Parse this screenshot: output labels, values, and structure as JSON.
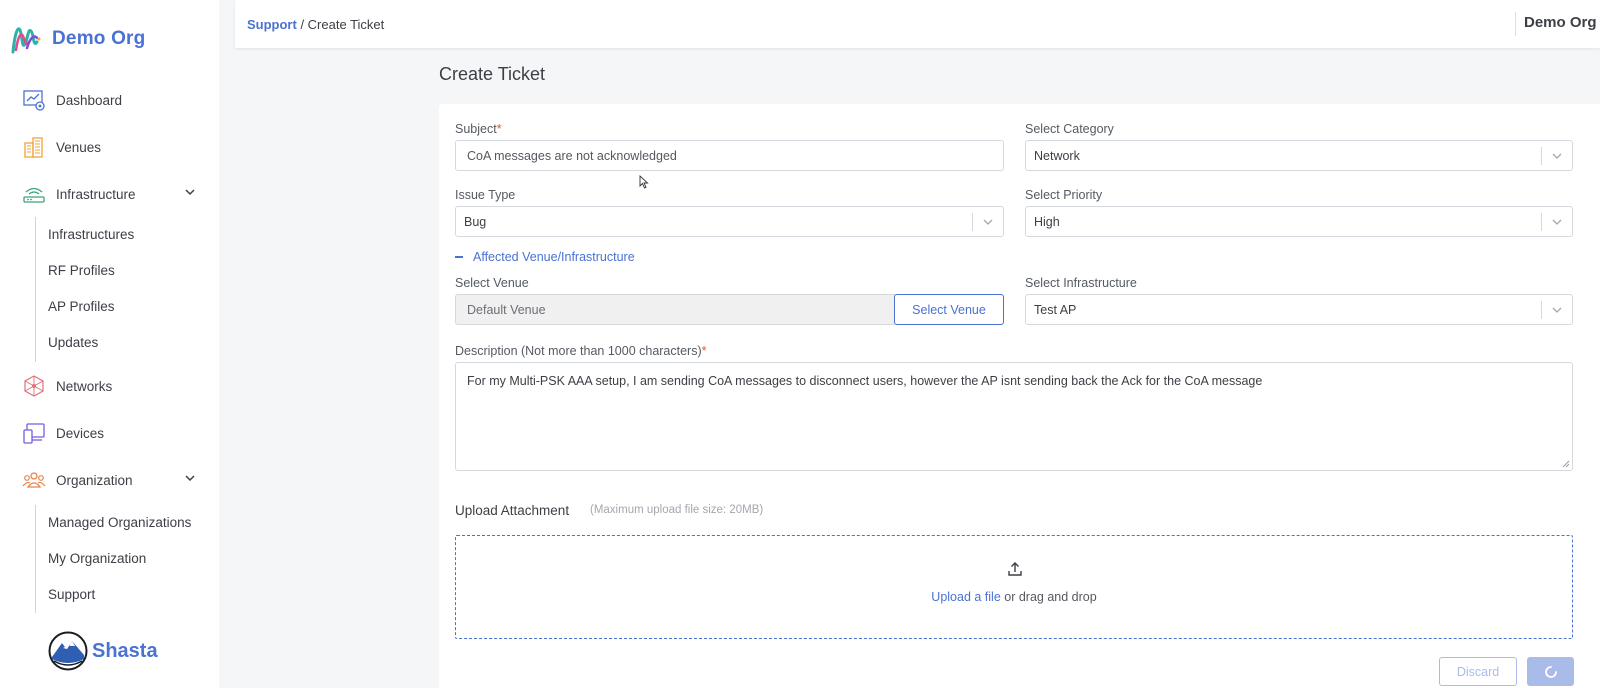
{
  "sidebar": {
    "org_name": "Demo Org",
    "items": [
      {
        "label": "Dashboard",
        "icon": "dashboard-icon"
      },
      {
        "label": "Venues",
        "icon": "venues-icon"
      },
      {
        "label": "Infrastructure",
        "icon": "infrastructure-icon"
      },
      {
        "label": "Networks",
        "icon": "networks-icon"
      },
      {
        "label": "Devices",
        "icon": "devices-icon"
      },
      {
        "label": "Organization",
        "icon": "organization-icon"
      }
    ],
    "infrastructure_sub": [
      "Infrastructures",
      "RF Profiles",
      "AP Profiles",
      "Updates"
    ],
    "organization_sub": [
      "Managed Organizations",
      "My Organization",
      "Support"
    ],
    "footer_brand": "Shasta"
  },
  "topbar": {
    "breadcrumb_parent": "Support",
    "breadcrumb_sep": " / ",
    "breadcrumb_current": "Create Ticket",
    "org_label": "Demo Org"
  },
  "page": {
    "title": "Create Ticket"
  },
  "form": {
    "subject_label": "Subject",
    "subject_value": "CoA messages are not acknowledged",
    "category_label": "Select Category",
    "category_value": "Network",
    "issue_type_label": "Issue Type",
    "issue_type_value": "Bug",
    "priority_label": "Select Priority",
    "priority_value": "High",
    "affected_toggle": "Affected Venue/Infrastructure",
    "venue_label": "Select Venue",
    "venue_value": "Default Venue",
    "venue_button": "Select Venue",
    "infrastructure_label": "Select Infrastructure",
    "infrastructure_value": "Test AP",
    "description_label": "Description (Not more than 1000 characters)",
    "description_value": "For my Multi-PSK AAA setup, I am sending CoA messages to disconnect users, however the AP isnt sending back the Ack for the CoA message",
    "required_mark": "*",
    "upload_title": "Upload Attachment",
    "upload_hint": "(Maximum upload file size: 20MB)",
    "upload_link": "Upload a file",
    "upload_rest": " or drag and drop",
    "discard_label": "Discard"
  },
  "colors": {
    "accent": "#4a72d3",
    "required": "#e5533d",
    "disabled_accent": "#a9bce9"
  }
}
